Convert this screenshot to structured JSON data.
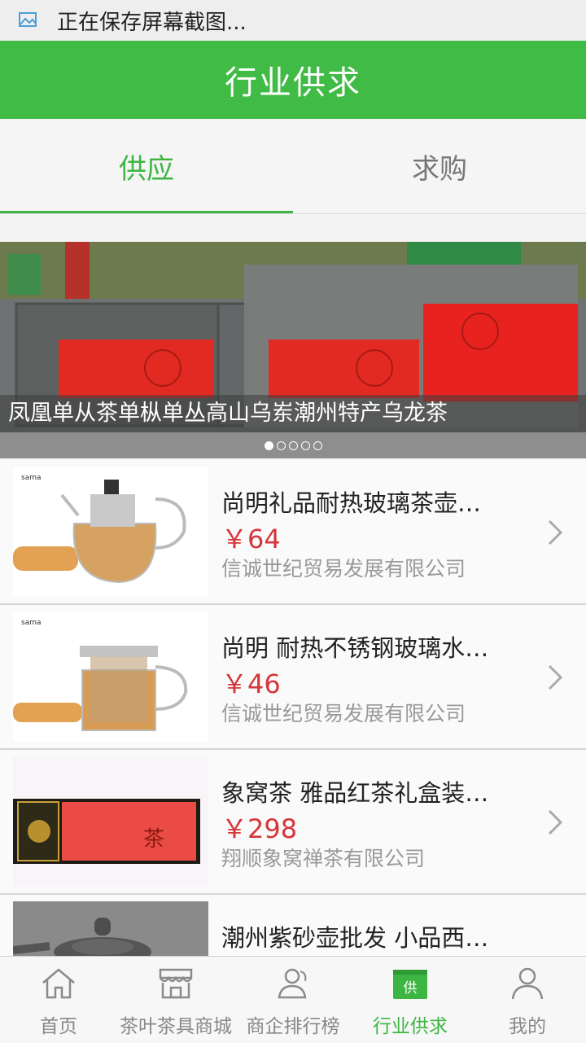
{
  "status_bar": {
    "notification_text": "正在保存屏幕截图..."
  },
  "header": {
    "title": "行业供求"
  },
  "tabs": [
    {
      "label": "供应",
      "active": true
    },
    {
      "label": "求购",
      "active": false
    }
  ],
  "banner": {
    "caption": "凤凰单从茶单枞单丛高山乌岽潮州特产乌龙茶",
    "slide_count": 5,
    "active_slide": 1
  },
  "products": [
    {
      "name": "尚明礼品耐热玻璃茶壶…",
      "price": "￥64",
      "company": "信诚世纪贸易发展有限公司"
    },
    {
      "name": "尚明 耐热不锈钢玻璃水…",
      "price": "￥46",
      "company": "信诚世纪贸易发展有限公司"
    },
    {
      "name": "象窝茶 雅品红茶礼盒装…",
      "price": "￥298",
      "company": "翔顺象窝禅茶有限公司"
    },
    {
      "name": "潮州紫砂壶批发 小品西…",
      "price": "",
      "company": ""
    }
  ],
  "bottom_nav": [
    {
      "label": "首页",
      "icon": "home-icon",
      "active": false
    },
    {
      "label": "茶叶茶具商城",
      "icon": "store-icon",
      "active": false
    },
    {
      "label": "商企排行榜",
      "icon": "users-icon",
      "active": false
    },
    {
      "label": "行业供求",
      "icon": "supply-icon",
      "active": true,
      "badge": "供"
    },
    {
      "label": "我的",
      "icon": "profile-icon",
      "active": false
    }
  ],
  "colors": {
    "accent": "#40bb45",
    "price": "#d4363a"
  }
}
